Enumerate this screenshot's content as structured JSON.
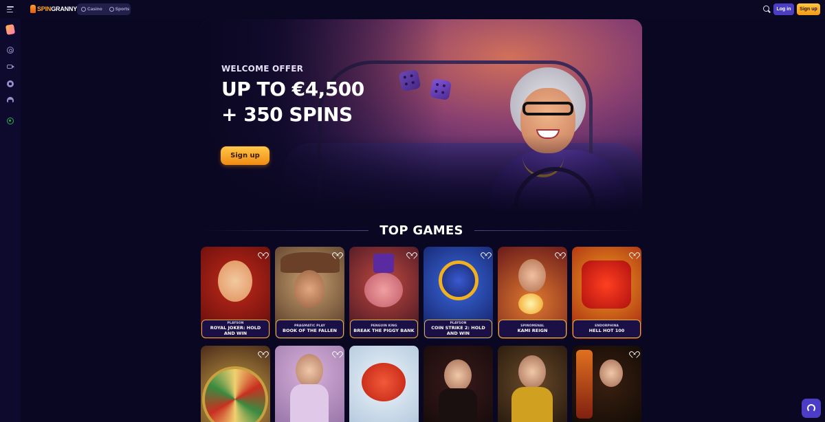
{
  "header": {
    "logo_text_a": "SPIN",
    "logo_text_b": "GRANNY",
    "mode_casino": "Casino",
    "mode_sports": "Sports",
    "login_label": "Log in",
    "signup_label": "Sign up"
  },
  "sidebar": {
    "items": [
      {
        "icon": "promo-icon"
      },
      {
        "icon": "casino-chip-icon"
      },
      {
        "icon": "live-camera-icon"
      },
      {
        "icon": "sports-ball-icon"
      },
      {
        "icon": "hand-icon"
      },
      {
        "icon": "responsible-gaming-icon"
      }
    ]
  },
  "hero": {
    "eyebrow": "WELCOME OFFER",
    "line1": "UP TO €4,500",
    "line2": "+ 350 SPINS",
    "cta": "Sign up"
  },
  "top_games": {
    "title": "TOP GAMES",
    "row1": [
      {
        "provider": "PLAYSON",
        "name": "ROYAL JOKER: HOLD AND WIN"
      },
      {
        "provider": "PRAGMATIC PLAY",
        "name": "BOOK OF THE FALLEN"
      },
      {
        "provider": "PENGUIN KING",
        "name": "BREAK THE PIGGY BANK"
      },
      {
        "provider": "PLAYSON",
        "name": "COIN STRIKE 2: HOLD AND WIN"
      },
      {
        "provider": "SPINOMENAL",
        "name": "KAMI REIGN"
      },
      {
        "provider": "ENDORPHINA",
        "name": "HELL HOT 100"
      }
    ]
  },
  "colors": {
    "background": "#0a0722",
    "accent_purple": "#4b3ec4",
    "accent_orange": "#f59a16",
    "card_border_gold": "#d8b14a"
  }
}
